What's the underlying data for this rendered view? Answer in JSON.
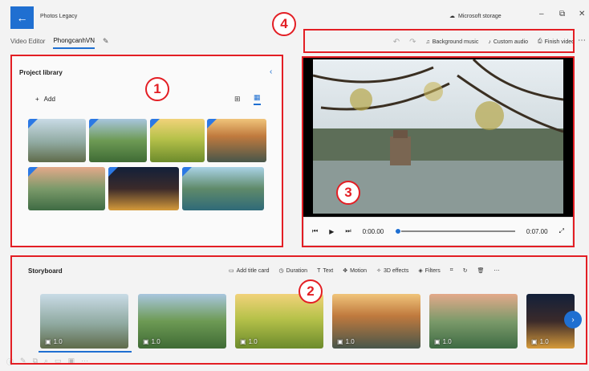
{
  "app": {
    "title": "Photos Legacy",
    "storage": "Microsoft storage"
  },
  "breadcrumb": {
    "items": [
      "Video Editor",
      "PhongcanhVN"
    ]
  },
  "toolbar": {
    "background_music": "Background music",
    "custom_audio": "Custom audio",
    "finish_video": "Finish video"
  },
  "library": {
    "title": "Project library",
    "add_label": "Add"
  },
  "player": {
    "current_time": "0:00.00",
    "total_time": "0:07.00"
  },
  "storyboard": {
    "title": "Storyboard",
    "tools": {
      "add_title_card": "Add title card",
      "duration": "Duration",
      "text": "Text",
      "motion": "Motion",
      "effects": "3D effects",
      "filters": "Filters"
    },
    "clips": [
      {
        "duration": "1.0"
      },
      {
        "duration": "1.0"
      },
      {
        "duration": "1.0"
      },
      {
        "duration": "1.0"
      },
      {
        "duration": "1.0"
      },
      {
        "duration": "1.0"
      }
    ]
  },
  "callouts": {
    "one": "1",
    "two": "2",
    "three": "3",
    "four": "4"
  },
  "colors": {
    "accent": "#1f6fd1",
    "callout": "#e31e24"
  }
}
